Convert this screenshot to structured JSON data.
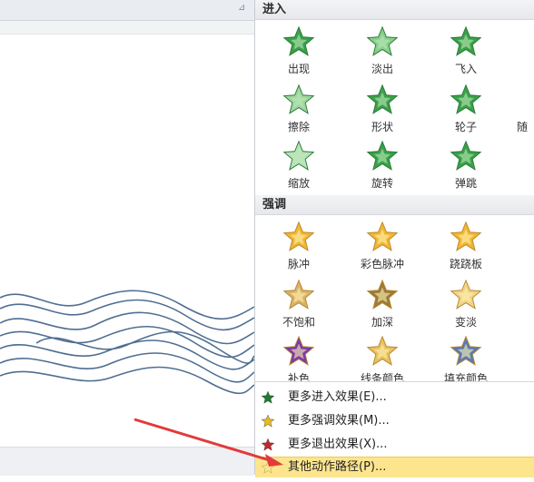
{
  "sections": {
    "entrance": {
      "title": "进入",
      "effects": [
        {
          "label": "出现",
          "icon": "appear-star-icon"
        },
        {
          "label": "淡出",
          "icon": "fade-star-icon"
        },
        {
          "label": "飞入",
          "icon": "fly-in-star-icon"
        },
        {
          "label": "擦除",
          "icon": "wipe-star-icon"
        },
        {
          "label": "形状",
          "icon": "shape-star-icon"
        },
        {
          "label": "轮子",
          "icon": "wheel-star-icon"
        },
        {
          "label": "缩放",
          "icon": "zoom-star-icon"
        },
        {
          "label": "旋转",
          "icon": "spin-star-icon"
        },
        {
          "label": "弹跳",
          "icon": "bounce-star-icon"
        }
      ],
      "partial_label": "随"
    },
    "emphasis": {
      "title": "强调",
      "effects": [
        {
          "label": "脉冲",
          "icon": "pulse-star-icon"
        },
        {
          "label": "彩色脉冲",
          "icon": "color-pulse-star-icon"
        },
        {
          "label": "跷跷板",
          "icon": "teeter-star-icon"
        },
        {
          "label": "不饱和",
          "icon": "desaturate-star-icon"
        },
        {
          "label": "加深",
          "icon": "darken-star-icon"
        },
        {
          "label": "变淡",
          "icon": "lighten-star-icon"
        },
        {
          "label": "补色",
          "icon": "complementary-color-star-icon"
        },
        {
          "label": "线条颜色",
          "icon": "line-color-star-icon"
        },
        {
          "label": "填充颜色",
          "icon": "fill-color-star-icon"
        }
      ]
    }
  },
  "menu": [
    {
      "label": "更多进入效果(E)...",
      "icon": "entrance-effect-star-icon",
      "color": "#1e7a2e"
    },
    {
      "label": "更多强调效果(M)...",
      "icon": "emphasis-effect-star-icon",
      "color": "#e8b923"
    },
    {
      "label": "更多退出效果(X)...",
      "icon": "exit-effect-star-icon",
      "color": "#c0282d"
    },
    {
      "label": "其他动作路径(P)...",
      "icon": "motion-path-star-icon",
      "color": "#9a8a4a"
    }
  ],
  "colors": {
    "entrance_green": "#3aa04a",
    "emphasis_gold": "#f2b632",
    "wave_blue": "#4f6e92",
    "arrow_red": "#e23a3a",
    "hover_yellow": "#fde58e"
  }
}
